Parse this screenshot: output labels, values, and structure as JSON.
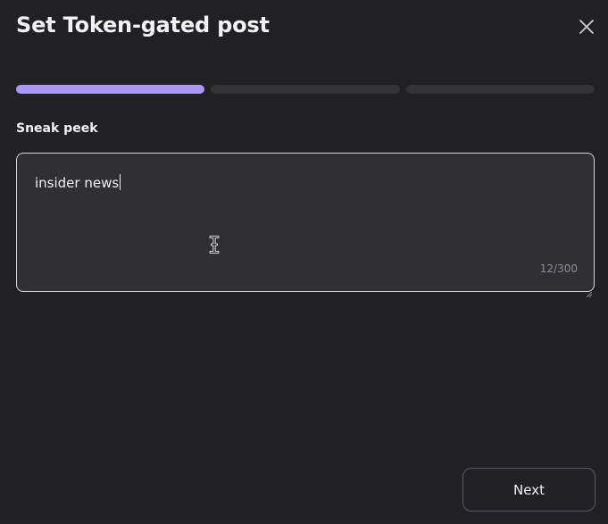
{
  "modal": {
    "title": "Set Token-gated post",
    "close_icon": "close-icon"
  },
  "progress": {
    "total_steps": 3,
    "current_step": 1,
    "active_color": "#a997f2",
    "inactive_color": "#333237"
  },
  "form": {
    "sneak_peek_label": "Sneak peek",
    "sneak_peek_value": "insider news",
    "char_count": "12/300"
  },
  "footer": {
    "next_label": "Next"
  }
}
